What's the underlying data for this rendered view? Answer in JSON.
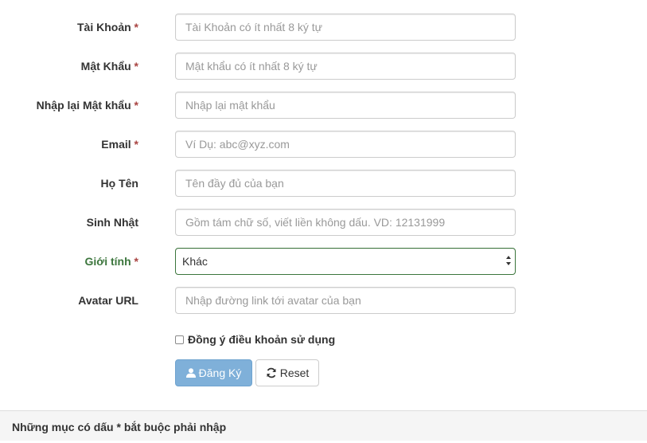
{
  "form": {
    "fields": [
      {
        "label": "Tài Khoản",
        "required_mark": "*",
        "placeholder": "Tài Khoản có ít nhất 8 ký tự"
      },
      {
        "label": "Mật Khẩu",
        "required_mark": "*",
        "placeholder": "Mật khẩu có ít nhất 8 ký tự"
      },
      {
        "label": "Nhập lại Mật khẩu",
        "required_mark": "*",
        "placeholder": "Nhập lại mật khẩu"
      },
      {
        "label": "Email",
        "required_mark": "*",
        "placeholder": "Ví Dụ: abc@xyz.com"
      },
      {
        "label": "Họ Tên",
        "placeholder": "Tên đầy đủ của bạn"
      },
      {
        "label": "Sinh Nhật",
        "placeholder": "Gồm tám chữ số, viết liền không dấu. VD: 12131999"
      },
      {
        "label": "Giới tính",
        "required_mark": "*",
        "value": "Khác"
      },
      {
        "label": "Avatar URL",
        "placeholder": "Nhập đường link tới avatar của bạn"
      }
    ],
    "terms_label": "Đồng ý điều khoản sử dụng",
    "submit_label": "Đăng Ký",
    "reset_label": "Reset"
  },
  "footer": {
    "note": "Những mục có dấu * bắt buộc phải nhập"
  },
  "colors": {
    "required": "#a94442",
    "success": "#3c763d",
    "primary_button": "#7fb0d9"
  },
  "icons": {
    "submit": "user-icon",
    "reset": "refresh-icon",
    "select": "select-arrows-icon"
  }
}
